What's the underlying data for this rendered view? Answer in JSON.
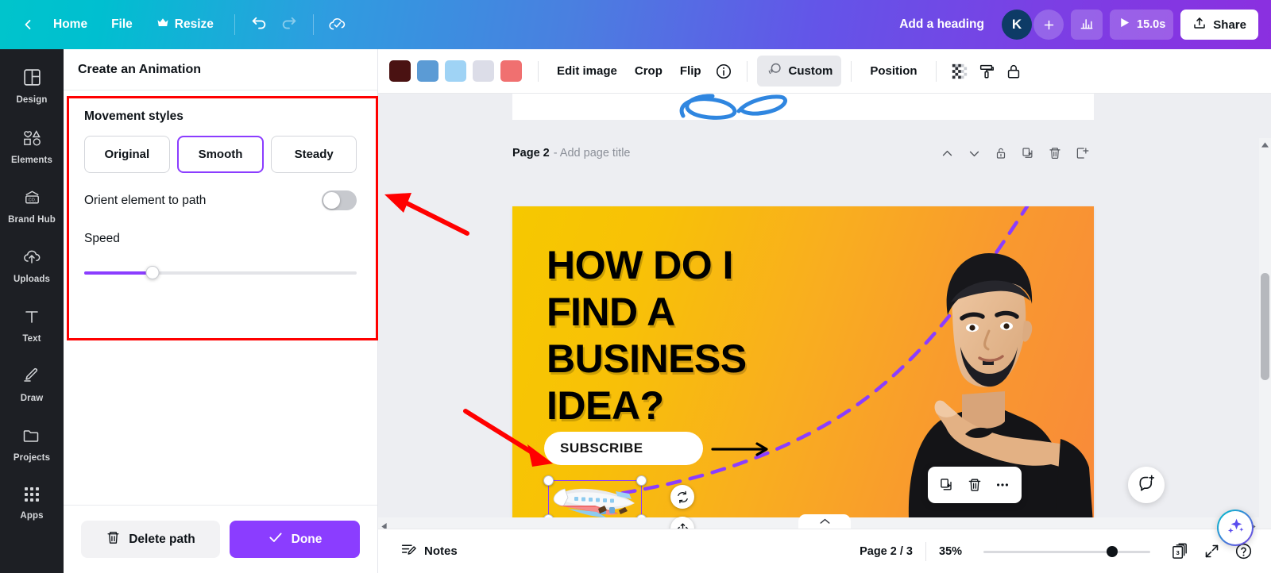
{
  "topbar": {
    "back_icon": "chevron-left-icon",
    "home_label": "Home",
    "file_label": "File",
    "resize_label": "Resize",
    "resize_icon": "crown-icon",
    "undo_icon": "undo-icon",
    "redo_icon": "redo-icon",
    "cloud_icon": "cloud-check-icon",
    "heading_label": "Add a heading",
    "avatar_initial": "K",
    "add_collaborator_icon": "plus-icon",
    "insights_icon": "bar-chart-icon",
    "play_icon": "play-icon",
    "duration_label": "15.0s",
    "share_label": "Share",
    "share_icon": "upload-icon",
    "gradient_start": "#00c4cc",
    "gradient_end": "#8b2fe0"
  },
  "rail": {
    "items": [
      {
        "label": "Design",
        "icon": "layout-icon"
      },
      {
        "label": "Elements",
        "icon": "shapes-icon"
      },
      {
        "label": "Brand Hub",
        "icon": "brand-icon"
      },
      {
        "label": "Uploads",
        "icon": "upload-cloud-icon"
      },
      {
        "label": "Text",
        "icon": "text-icon"
      },
      {
        "label": "Draw",
        "icon": "pencil-icon"
      },
      {
        "label": "Projects",
        "icon": "folder-icon"
      },
      {
        "label": "Apps",
        "icon": "grid-apps-icon"
      }
    ]
  },
  "panel": {
    "title": "Create an Animation",
    "section_title": "Movement styles",
    "styles": [
      {
        "label": "Original",
        "selected": false
      },
      {
        "label": "Smooth",
        "selected": true
      },
      {
        "label": "Steady",
        "selected": false
      }
    ],
    "orient_label": "Orient element to path",
    "orient_on": false,
    "speed_label": "Speed",
    "speed_percent": 25,
    "delete_label": "Delete path",
    "delete_icon": "trash-icon",
    "done_label": "Done",
    "done_icon": "check-icon",
    "accent_color": "#8b3dff",
    "highlight_color": "#ff0000"
  },
  "toolbar": {
    "swatches": [
      "#4a1212",
      "#5b9bd5",
      "#9fd3f5",
      "#dcdde8",
      "#f07070"
    ],
    "edit_image_label": "Edit image",
    "crop_label": "Crop",
    "flip_label": "Flip",
    "info_icon": "info-icon",
    "custom_label": "Custom",
    "custom_icon": "animate-icon",
    "custom_active": true,
    "position_label": "Position",
    "transparency_icon": "transparency-icon",
    "paint_icon": "paint-roller-icon",
    "lock_icon": "lock-icon"
  },
  "page": {
    "label": "Page 2",
    "title_placeholder": "- Add page title",
    "move_up_icon": "chevron-up-icon",
    "move_down_icon": "chevron-down-icon",
    "lock_icon": "unlock-icon",
    "duplicate_icon": "duplicate-icon",
    "delete_icon": "trash-icon",
    "add_page_icon": "add-page-icon"
  },
  "design": {
    "headline": "HOW DO I FIND A BUSINESS IDEA?",
    "subscribe_label": "SUBSCRIBE",
    "arrow_icon": "arrow-right-icon",
    "bg_gradient_start": "#f6c800",
    "bg_gradient_end": "#f9893a",
    "path_color": "#8b3dff"
  },
  "selection": {
    "float_duplicate_icon": "duplicate-icon",
    "float_delete_icon": "trash-icon",
    "float_more_icon": "more-dots-icon",
    "rotate_icon": "rotate-icon",
    "move_icon": "move-icon",
    "selected_element": "airplane-sticker"
  },
  "floating": {
    "comment_icon": "comment-add-icon",
    "magic_icon": "magic-sparkle-icon"
  },
  "statusbar": {
    "notes_label": "Notes",
    "notes_icon": "notes-icon",
    "page_count_label": "Page 2 / 3",
    "zoom_label": "35%",
    "zoom_percent": 35,
    "pages_badge": "3",
    "pages_icon": "pages-icon",
    "fullscreen_icon": "expand-icon",
    "help_icon": "help-icon",
    "collapse_icon": "chevron-up-icon"
  }
}
